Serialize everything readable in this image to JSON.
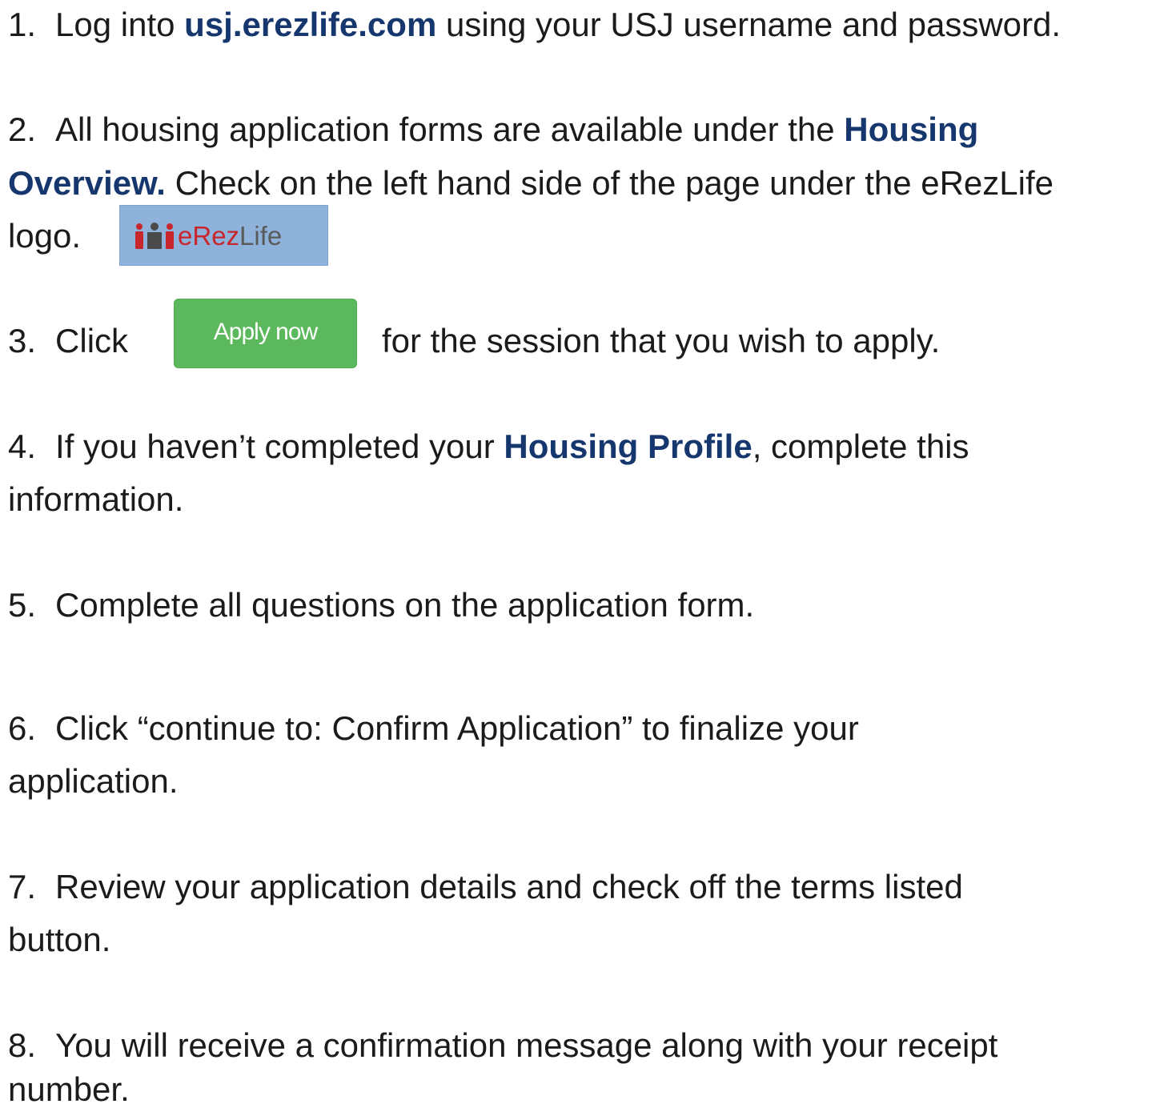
{
  "steps": [
    {
      "num": "1.",
      "pre": "Log into ",
      "link": "usj.erezlife.com",
      "post": " using your USJ username and password."
    },
    {
      "num": "2.",
      "pre": "All housing application forms are available under the ",
      "link_a": "Housing",
      "link_b": "Overview.",
      "post": " Check on the left hand side of the page under the eRezLife",
      "last": "logo."
    },
    {
      "num": "3.",
      "pre": "Click",
      "post": "for the session that you wish to apply."
    },
    {
      "num": "4.",
      "pre": "If you haven’t completed your ",
      "link": "Housing Profile",
      "post": ", complete this",
      "last": "information."
    },
    {
      "num": "5.",
      "text": "Complete all questions on the application form."
    },
    {
      "num": "6.",
      "text": "Click “continue to: Confirm Application” to finalize your",
      "last": "application."
    },
    {
      "num": "7.",
      "text": "Review your application details and check off the terms listed",
      "last": "button."
    },
    {
      "num": "8.",
      "text": "You will receive a confirmation message along with your receipt",
      "last": "number."
    }
  ],
  "logo": {
    "text_e": "e",
    "text_rez": "Rez",
    "text_life": "Life",
    "icon": "erezlife-people-icon",
    "background": "#8fb2da"
  },
  "apply_button": {
    "label": "Apply now",
    "color": "#5cb85c"
  },
  "colors": {
    "link": "#16376e",
    "text": "#1b1b1b"
  }
}
